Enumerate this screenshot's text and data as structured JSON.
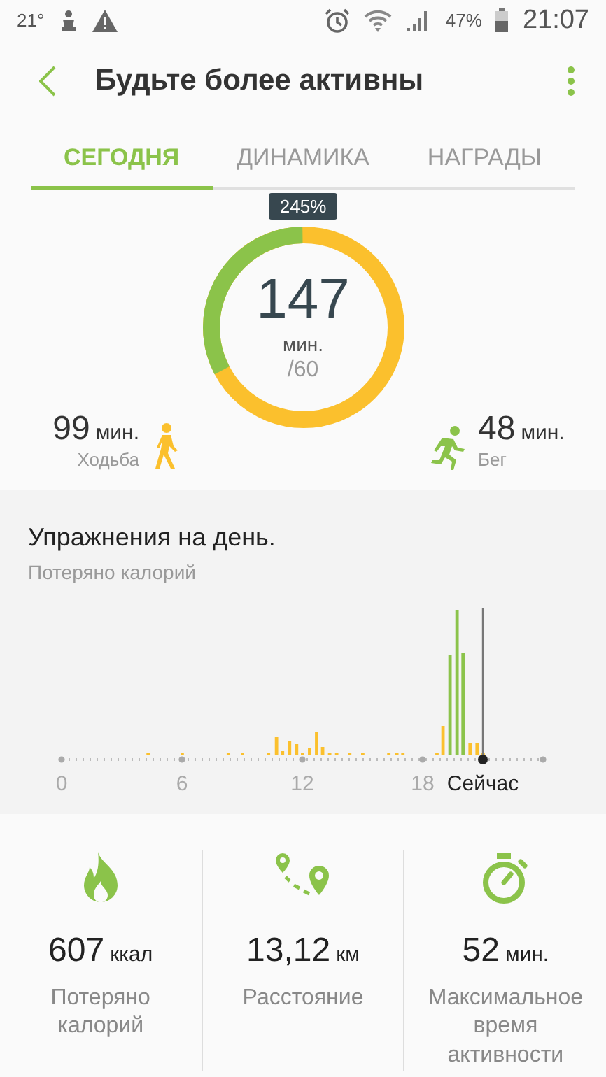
{
  "status_bar": {
    "temperature": "21°",
    "battery_percent": "47%",
    "time": "21:07"
  },
  "header": {
    "title": "Будьте более активны"
  },
  "tabs": [
    {
      "label": "СЕГОДНЯ",
      "selected": true
    },
    {
      "label": "ДИНАМИКА",
      "selected": false
    },
    {
      "label": "НАГРАДЫ",
      "selected": false
    }
  ],
  "summary": {
    "badge": "245%",
    "total": "147",
    "unit": "мин.",
    "goal": "/60",
    "activities": [
      {
        "kind": "walk",
        "value": "99",
        "unit": "мин.",
        "label": "Ходьба",
        "color": "#fbc02d"
      },
      {
        "kind": "run",
        "value": "48",
        "unit": "мин.",
        "label": "Бег",
        "color": "#8bc34a"
      }
    ]
  },
  "chart_section": {
    "title": "Упражнения на день.",
    "subtitle": "Потеряно калорий",
    "x_labels": [
      "0",
      "6",
      "12",
      "18"
    ],
    "now_label": "Сейчас"
  },
  "stats": [
    {
      "kind": "calories",
      "value": "607",
      "unit": "ккал",
      "label": "Потеряно калорий"
    },
    {
      "kind": "distance",
      "value": "13,12",
      "unit": "км",
      "label": "Расстояние"
    },
    {
      "kind": "time",
      "value": "52",
      "unit": "мин.",
      "label": "Максимальное время активности"
    }
  ]
}
